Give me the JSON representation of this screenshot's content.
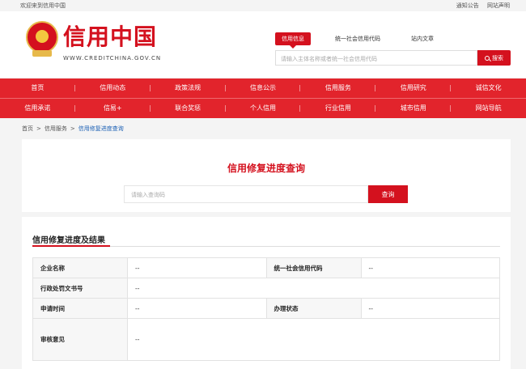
{
  "topbar": {
    "welcome": "欢迎来到信用中国",
    "links": [
      "通知公告",
      "网站声明"
    ]
  },
  "header": {
    "logo_text": "信用中国",
    "logo_sub": "WWW.CREDITCHINA.GOV.CN",
    "search_tabs": [
      "信用信息",
      "统一社会信用代码",
      "站内文章"
    ],
    "search_placeholder": "请输入主体名称或者统一社会信用代码",
    "search_button": "搜索"
  },
  "nav": {
    "row1": [
      "首页",
      "信用动态",
      "政策法规",
      "信息公示",
      "信用服务",
      "信用研究",
      "诚信文化"
    ],
    "row2": [
      "信用承诺",
      "信易+",
      "联合奖惩",
      "个人信用",
      "行业信用",
      "城市信用",
      "网站导航"
    ]
  },
  "breadcrumb": [
    "首页",
    "信用服务",
    "信用修复进度查询"
  ],
  "query": {
    "title": "信用修复进度查询",
    "placeholder": "请输入查询码",
    "button": "查询"
  },
  "result": {
    "title": "信用修复进度及结果",
    "fields": {
      "company_label": "企业名称",
      "company_value": "--",
      "code_label": "统一社会信用代码",
      "code_value": "--",
      "penalty_label": "行政处罚文书号",
      "penalty_value": "--",
      "apply_time_label": "申请时间",
      "apply_time_value": "--",
      "status_label": "办理状态",
      "status_value": "--",
      "opinion_label": "审核意见",
      "opinion_value": "--"
    }
  },
  "colors": {
    "brand_red": "#d4111e",
    "nav_red": "#e2242c",
    "link_blue": "#1a5fb4"
  }
}
